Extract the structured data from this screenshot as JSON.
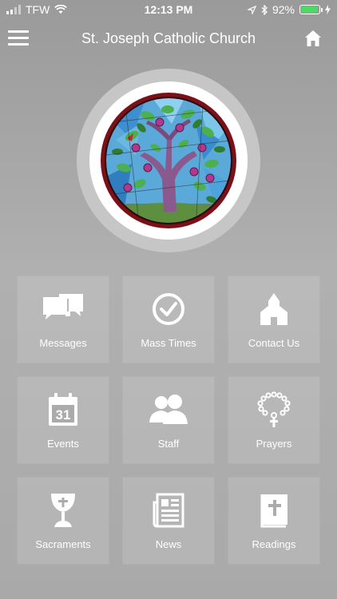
{
  "status_bar": {
    "carrier": "TFW",
    "time": "12:13 PM",
    "battery_percent": "92%",
    "battery_level": 0.92,
    "colors": {
      "battery": "#4cd964"
    }
  },
  "header": {
    "title": "St. Joseph Catholic Church",
    "menu_icon": "hamburger-menu-icon",
    "home_icon": "home-icon"
  },
  "logo": {
    "image": "stained-glass-tree-window"
  },
  "tiles": [
    {
      "label": "Messages",
      "icon": "chat-bubbles-icon"
    },
    {
      "label": "Mass Times",
      "icon": "clock-icon"
    },
    {
      "label": "Contact Us",
      "icon": "church-building-icon"
    },
    {
      "label": "Events",
      "icon": "calendar-icon",
      "icon_text": "31"
    },
    {
      "label": "Staff",
      "icon": "people-icon"
    },
    {
      "label": "Prayers",
      "icon": "rosary-icon"
    },
    {
      "label": "Sacraments",
      "icon": "chalice-icon"
    },
    {
      "label": "News",
      "icon": "newspaper-icon"
    },
    {
      "label": "Readings",
      "icon": "bible-icon"
    }
  ]
}
